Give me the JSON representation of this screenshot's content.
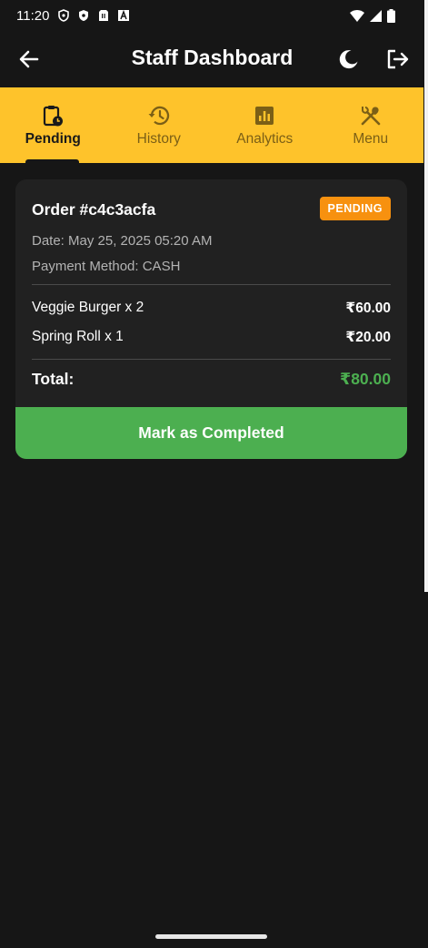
{
  "status_bar": {
    "time": "11:20"
  },
  "app_bar": {
    "title": "Staff Dashboard"
  },
  "tabs": [
    {
      "label": "Pending",
      "icon": "clipboard-clock-icon",
      "active": true
    },
    {
      "label": "History",
      "icon": "history-icon",
      "active": false
    },
    {
      "label": "Analytics",
      "icon": "analytics-icon",
      "active": false
    },
    {
      "label": "Menu",
      "icon": "fork-knife-icon",
      "active": false
    }
  ],
  "order": {
    "id": "Order #c4c3acfa",
    "status": "PENDING",
    "date": "Date: May 25, 2025 05:20 AM",
    "payment": "Payment Method: CASH",
    "items": [
      {
        "name": "Veggie Burger x 2",
        "price": "₹60.00"
      },
      {
        "name": "Spring Roll x 1",
        "price": "₹20.00"
      }
    ],
    "total_label": "Total:",
    "total_value": "₹80.00",
    "action_label": "Mark as Completed"
  },
  "colors": {
    "background": "#161616",
    "card": "#212121",
    "tab_bar": "#fec32b",
    "badge": "#f7910f",
    "success": "#4caf50"
  }
}
